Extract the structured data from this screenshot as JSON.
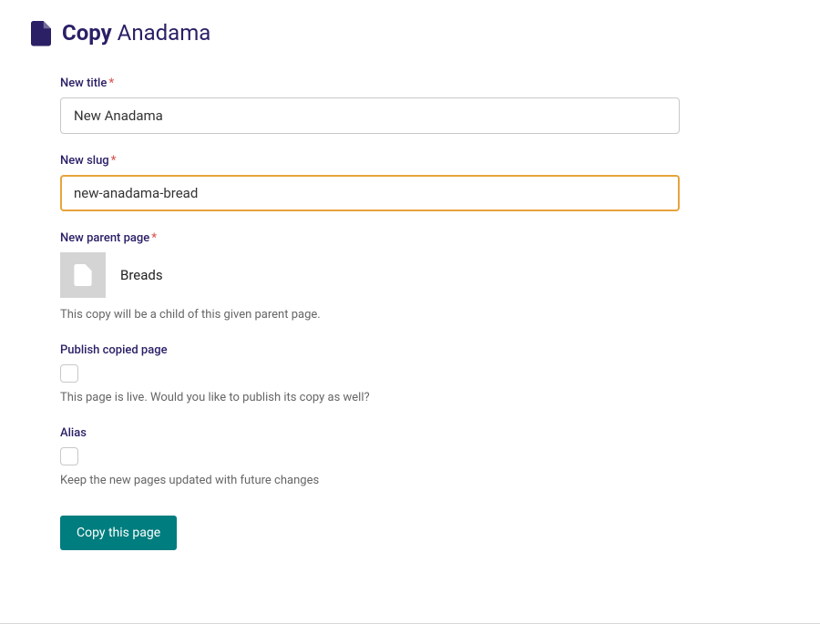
{
  "header": {
    "action": "Copy",
    "page_name": "Anadama"
  },
  "fields": {
    "new_title": {
      "label": "New title",
      "required": true,
      "value": "New Anadama"
    },
    "new_slug": {
      "label": "New slug",
      "required": true,
      "value": "new-anadama-bread"
    },
    "new_parent": {
      "label": "New parent page",
      "required": true,
      "page_name": "Breads",
      "help": "This copy will be a child of this given parent page."
    },
    "publish": {
      "label": "Publish copied page",
      "checked": false,
      "help": "This page is live. Would you like to publish its copy as well?"
    },
    "alias": {
      "label": "Alias",
      "checked": false,
      "help": "Keep the new pages updated with future changes"
    }
  },
  "submit": {
    "label": "Copy this page"
  }
}
